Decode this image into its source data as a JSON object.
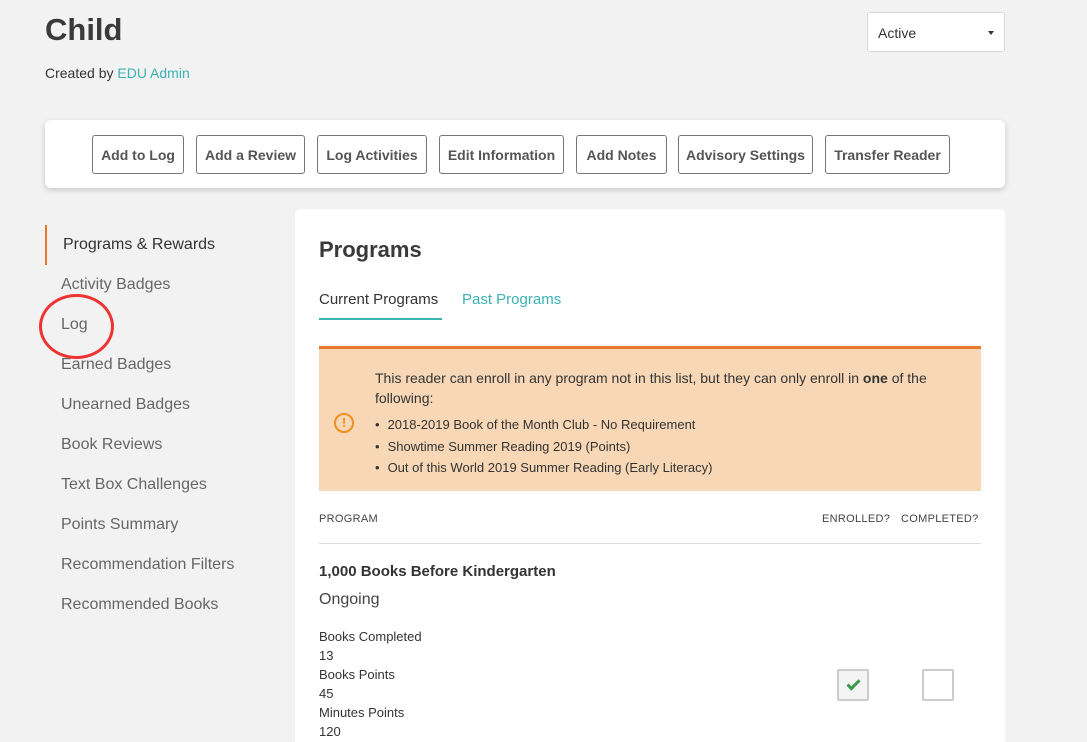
{
  "header": {
    "title": "Child",
    "created_by_prefix": "Created by",
    "created_by_name": "EDU Admin",
    "status_value": "Active"
  },
  "toolbar": {
    "buttons": [
      "Add to Log",
      "Add a Review",
      "Log Activities",
      "Edit Information",
      "Add Notes",
      "Advisory Settings",
      "Transfer Reader"
    ]
  },
  "sidebar": {
    "items": [
      {
        "label": "Programs & Rewards",
        "active": true
      },
      {
        "label": "Activity Badges"
      },
      {
        "label": "Log"
      },
      {
        "label": "Earned Badges"
      },
      {
        "label": "Unearned Badges"
      },
      {
        "label": "Book Reviews"
      },
      {
        "label": "Text Box Challenges"
      },
      {
        "label": "Points Summary"
      },
      {
        "label": "Recommendation Filters"
      },
      {
        "label": "Recommended Books"
      }
    ]
  },
  "main": {
    "title": "Programs",
    "tabs": [
      {
        "label": "Current Programs",
        "active": true
      },
      {
        "label": "Past Programs"
      }
    ],
    "alert": {
      "icon": "exclamation-circle-icon",
      "text_before": "This reader can enroll in any program not in this list, but they can only enroll in ",
      "text_bold": "one",
      "text_after": " of the following:",
      "items": [
        "2018-2019 Book of the Month Club - No Requirement",
        "Showtime Summer Reading 2019 (Points)",
        "Out of this World 2019 Summer Reading (Early Literacy)"
      ]
    },
    "columns": {
      "program": "PROGRAM",
      "enrolled": "ENROLLED?",
      "completed": "COMPLETED?"
    },
    "program": {
      "name": "1,000 Books Before Kindergarten",
      "status": "Ongoing",
      "stats": [
        "Books Completed",
        "13",
        "Books Points",
        "45",
        "Minutes Points",
        "120"
      ],
      "enrolled": true,
      "completed": false
    }
  },
  "colors": {
    "accent": "#3bb3b3",
    "active_border": "#e8792b",
    "alert_bg": "#f7d7b5",
    "annotation": "#ee3333"
  }
}
